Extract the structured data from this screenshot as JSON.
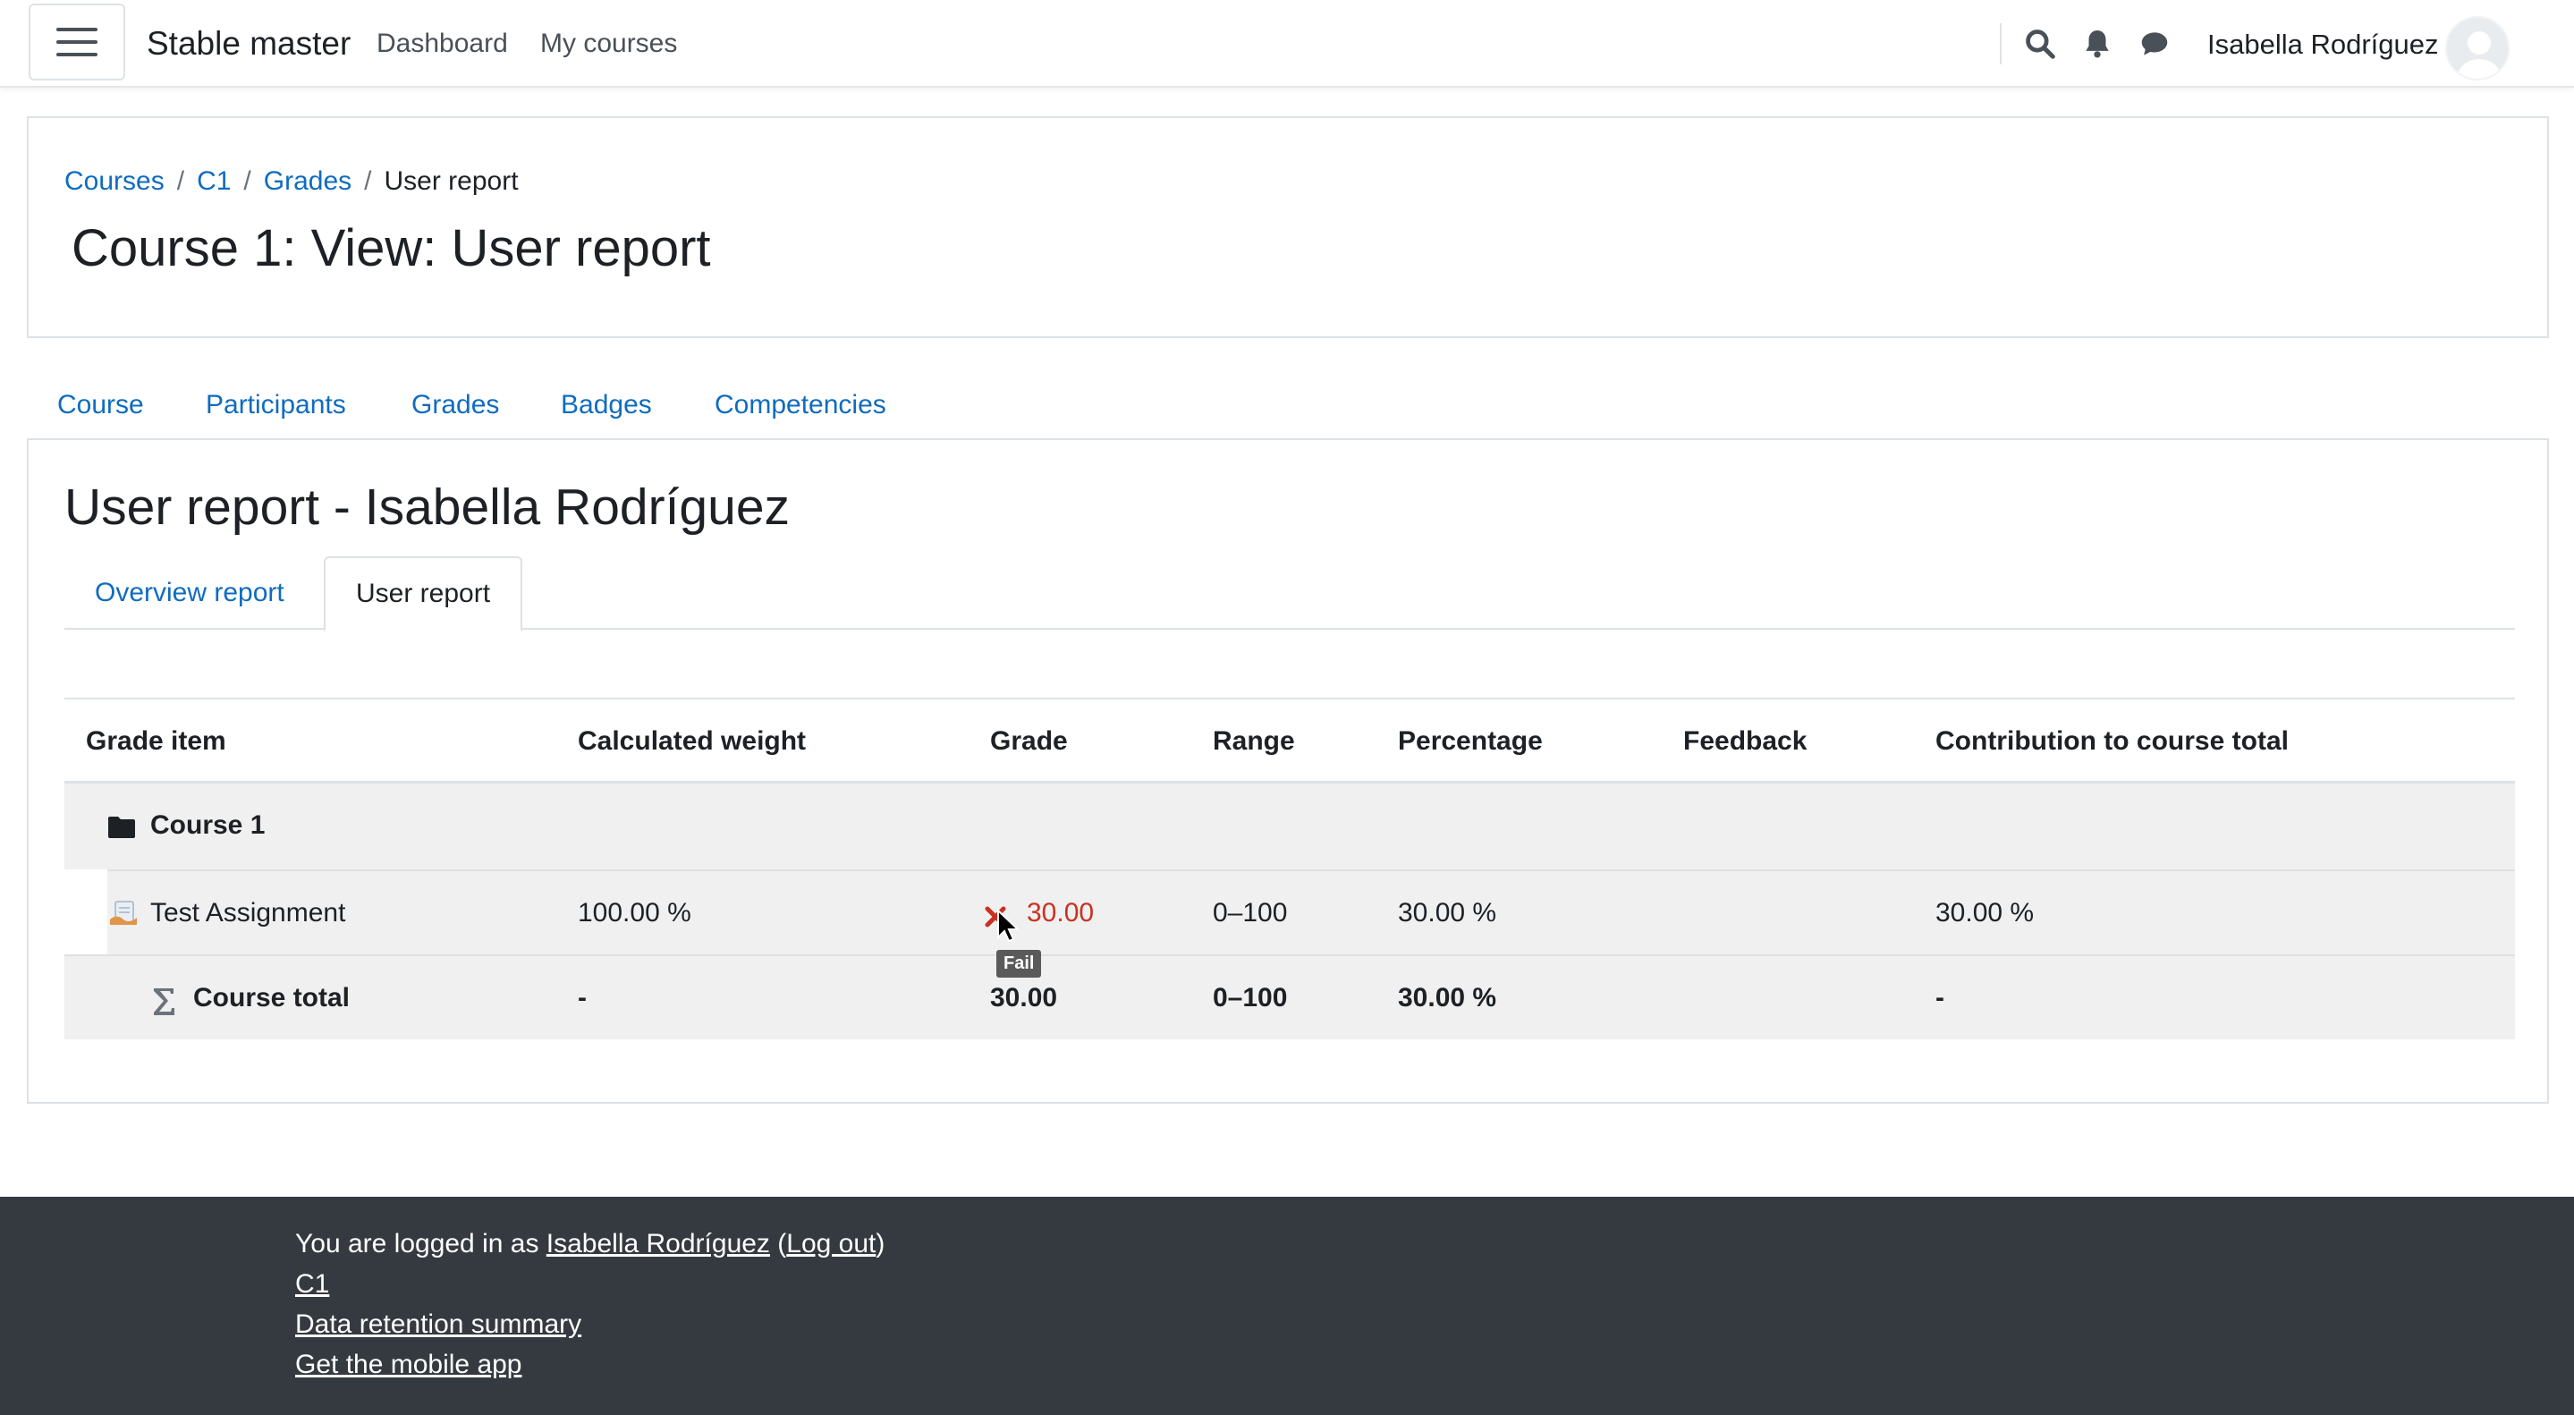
{
  "navbar": {
    "brand": "Stable master",
    "links": [
      "Dashboard",
      "My courses"
    ],
    "user_name": "Isabella Rodríguez",
    "icons": [
      "search-icon",
      "bell-icon",
      "chat-icon"
    ]
  },
  "header": {
    "breadcrumb": [
      "Courses",
      "C1",
      "Grades",
      "User report"
    ],
    "title": "Course 1: View: User report"
  },
  "course_tabs": [
    "Course",
    "Participants",
    "Grades",
    "Badges",
    "Competencies"
  ],
  "report": {
    "heading": "User report - Isabella Rodríguez",
    "subtabs": {
      "overview": "Overview report",
      "user": "User report"
    },
    "columns": [
      "Grade item",
      "Calculated weight",
      "Grade",
      "Range",
      "Percentage",
      "Feedback",
      "Contribution to course total"
    ],
    "category": {
      "name": "Course 1",
      "icon": "folder-icon"
    },
    "item": {
      "name": "Test Assignment",
      "icon": "assignment-icon",
      "weight": "100.00 %",
      "grade": "30.00",
      "grade_status_icon": "fail-x-icon",
      "range": "0–100",
      "percentage": "30.00 %",
      "feedback": "",
      "contribution": "30.00 %"
    },
    "total": {
      "name": "Course total",
      "icon": "sigma-icon",
      "weight": "-",
      "grade": "30.00",
      "range": "0–100",
      "percentage": "30.00 %",
      "feedback": "",
      "contribution": "-"
    },
    "tooltip": "Fail"
  },
  "footer": {
    "logged_prefix": "You are logged in as ",
    "user_link": "Isabella Rodríguez",
    "open_paren": " (",
    "logout": "Log out",
    "close_paren": ")",
    "links": [
      "C1",
      "Data retention summary",
      "Get the mobile app"
    ]
  },
  "colors": {
    "link": "#0f6cbf",
    "fail": "#ca3120",
    "footer_bg": "#343a40",
    "row_bg": "#f0f0f0"
  }
}
